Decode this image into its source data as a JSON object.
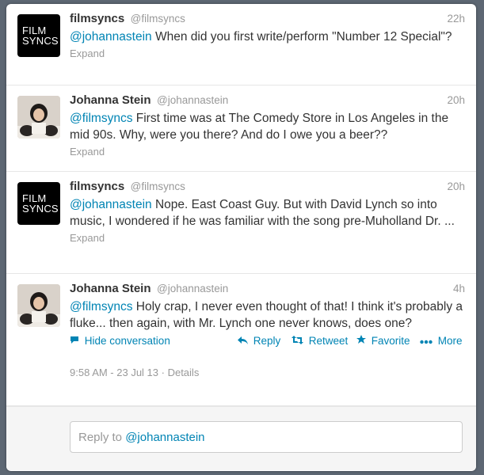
{
  "tweets": [
    {
      "name": "filmsyncs",
      "handle": "@filmsyncs",
      "time": "22h",
      "mention": "@johannastein",
      "text": " When did you first write/perform \"Number 12 Special\"?",
      "expand": "Expand",
      "avatar_lines": [
        "FILM",
        "SYNCS"
      ]
    },
    {
      "name": "Johanna Stein",
      "handle": "@johannastein",
      "time": "20h",
      "mention": "@filmsyncs",
      "text": "  First time was at The Comedy Store in Los Angeles in the mid 90s. Why, were you there? And do I owe you a beer??",
      "expand": "Expand"
    },
    {
      "name": "filmsyncs",
      "handle": "@filmsyncs",
      "time": "20h",
      "mention": "@johannastein",
      "text": " Nope.  East Coast Guy.  But with David Lynch so into music, I wondered if he was familiar with the song pre-Muholland Dr. ...",
      "expand": "Expand",
      "avatar_lines": [
        "FILM",
        "SYNCS"
      ]
    },
    {
      "name": "Johanna Stein",
      "handle": "@johannastein",
      "time": "4h",
      "mention": "@filmsyncs",
      "text": " Holy crap, I never even thought of that! I think it's probably a fluke... then again, with Mr. Lynch one never knows, does one?",
      "hide_conversation": "Hide conversation",
      "reply": "Reply",
      "retweet": "Retweet",
      "favorite": "Favorite",
      "more": "More",
      "timestamp": "9:58 AM - 23 Jul 13",
      "details": "Details"
    }
  ],
  "reply_box": {
    "prefix": "Reply to ",
    "mention": "@johannastein"
  },
  "icons": {
    "hide": "speech-bubble-icon",
    "reply": "reply-arrow-icon",
    "retweet": "retweet-icon",
    "favorite": "star-icon",
    "more": "ellipsis-icon"
  },
  "colors": {
    "link": "#0084b4",
    "meta": "#999999",
    "background": "#5d6773"
  }
}
